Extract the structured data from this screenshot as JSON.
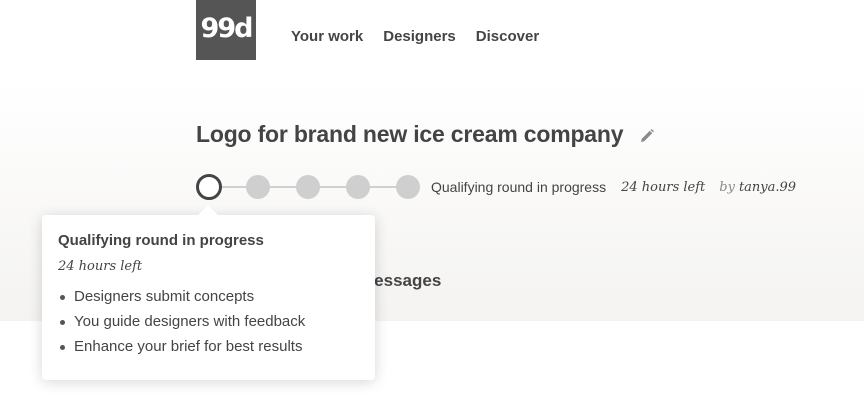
{
  "brand": {
    "logo_text": "99d"
  },
  "nav": {
    "items": [
      {
        "label": "Your work"
      },
      {
        "label": "Designers"
      },
      {
        "label": "Discover"
      }
    ]
  },
  "contest": {
    "title": "Logo for brand new ice cream company",
    "status": "Qualifying round in progress",
    "time_left": "24 hours left",
    "by_label": "by",
    "owner": "tanya.99",
    "steps_total": 5,
    "current_step": 1
  },
  "tabs": {
    "messages": "Messages"
  },
  "tooltip": {
    "title": "Qualifying round in progress",
    "time_left": "24 hours left",
    "items": [
      "Designers submit concepts",
      "You guide designers with feedback",
      "Enhance your brief for best results"
    ]
  },
  "colors": {
    "logo_bg": "#555555",
    "text": "#444444",
    "step_inactive": "#cfcfcf",
    "step_current_border": "#444444"
  }
}
